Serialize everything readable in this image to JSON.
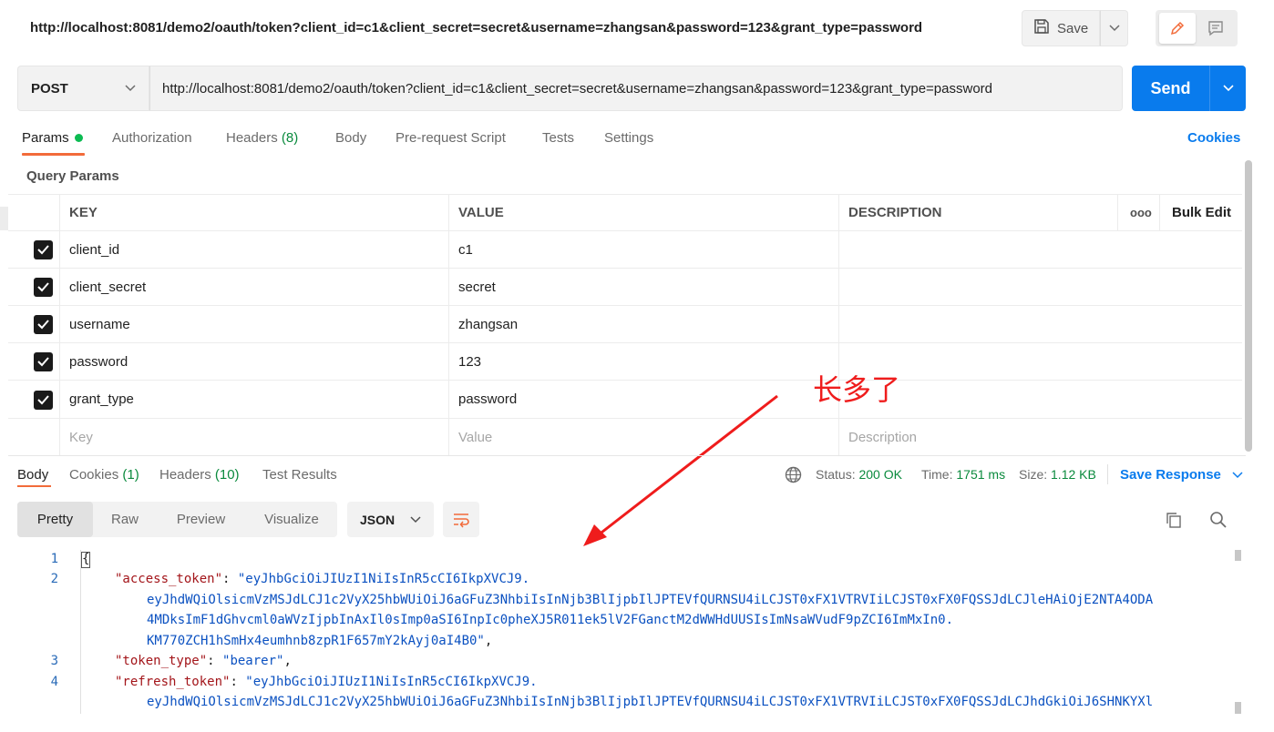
{
  "title_bar": {
    "url": "http://localhost:8081/demo2/oauth/token?client_id=c1&client_secret=secret&username=zhangsan&password=123&grant_type=password",
    "save_label": "Save",
    "save_icon": "floppy-disk-icon",
    "edit_icon": "pencil-icon",
    "doc_icon": "comment-icon"
  },
  "request": {
    "method": "POST",
    "url": "http://localhost:8081/demo2/oauth/token?client_id=c1&client_secret=secret&username=zhangsan&password=123&grant_type=password",
    "send_label": "Send"
  },
  "request_tabs": {
    "params": "Params",
    "authorization": "Authorization",
    "headers": "Headers",
    "headers_count": "(8)",
    "body": "Body",
    "prerequest": "Pre-request Script",
    "tests": "Tests",
    "settings": "Settings",
    "cookies": "Cookies"
  },
  "query_params": {
    "label": "Query Params",
    "columns": {
      "key": "KEY",
      "value": "VALUE",
      "description": "DESCRIPTION",
      "more": "ooo",
      "bulk_edit": "Bulk Edit"
    },
    "rows": [
      {
        "key": "client_id",
        "value": "c1",
        "checked": true
      },
      {
        "key": "client_secret",
        "value": "secret",
        "checked": true
      },
      {
        "key": "username",
        "value": "zhangsan",
        "checked": true
      },
      {
        "key": "password",
        "value": "123",
        "checked": true
      },
      {
        "key": "grant_type",
        "value": "password",
        "checked": true
      }
    ],
    "placeholder": {
      "key": "Key",
      "value": "Value",
      "description": "Description"
    }
  },
  "response": {
    "tabs": {
      "body": "Body",
      "cookies": "Cookies",
      "cookies_count": "(1)",
      "headers": "Headers",
      "headers_count": "(10)",
      "test_results": "Test Results"
    },
    "status_label": "Status:",
    "status_value": "200 OK",
    "time_label": "Time:",
    "time_value": "1751 ms",
    "size_label": "Size:",
    "size_value": "1.12 KB",
    "save_response": "Save Response",
    "views": {
      "pretty": "Pretty",
      "raw": "Raw",
      "preview": "Preview",
      "visualize": "Visualize"
    },
    "format": "JSON",
    "code": {
      "line_numbers": [
        "1",
        "2",
        "3",
        "4"
      ],
      "open_brace": "{",
      "access_token_key": "\"access_token\"",
      "access_token_l1": "\"eyJhbGciOiJIUzI1NiIsInR5cCI6IkpXVCJ9.",
      "access_token_l2": "eyJhdWQiOlsicmVzMSJdLCJ1c2VyX25hbWUiOiJ6aGFuZ3NhbiIsInNjb3BlIjpbIlJPTEVfQURNSU4iLCJST0xFX1VTRVIiLCJST0xFX0FQSSJdLCJleHAiOjE2NTA4ODA",
      "access_token_l3": "4MDksImF1dGhvcml0aWVzIjpbInAxIl0sImp0aSI6InpIc0pheXJ5R011ek5lV2FGanctM2dWWHdUUSIsImNsaWVudF9pZCI6ImMxIn0.",
      "access_token_l4": "KM770ZCH1hSmHx4eumhnb8zpR1F657mY2kAyj0aI4B0\"",
      "token_type_key": "\"token_type\"",
      "token_type_val": "\"bearer\"",
      "refresh_token_key": "\"refresh_token\"",
      "refresh_token_l1": "\"eyJhbGciOiJIUzI1NiIsInR5cCI6IkpXVCJ9.",
      "refresh_token_l2": "eyJhdWQiOlsicmVzMSJdLCJ1c2VyX25hbWUiOiJ6aGFuZ3NhbiIsInNjb3BlIjpbIlJPTEVfQURNSU4iLCJST0xFX1VTRVIiLCJST0xFX0FQSSJdLCJhdGkiOiJ6SHNKYXl"
    }
  },
  "annotation": "长多了",
  "colors": {
    "accent": "#f26b3a",
    "send": "#097bed",
    "status_ok": "#0a8a3d",
    "annotation": "#ef1c1c"
  }
}
